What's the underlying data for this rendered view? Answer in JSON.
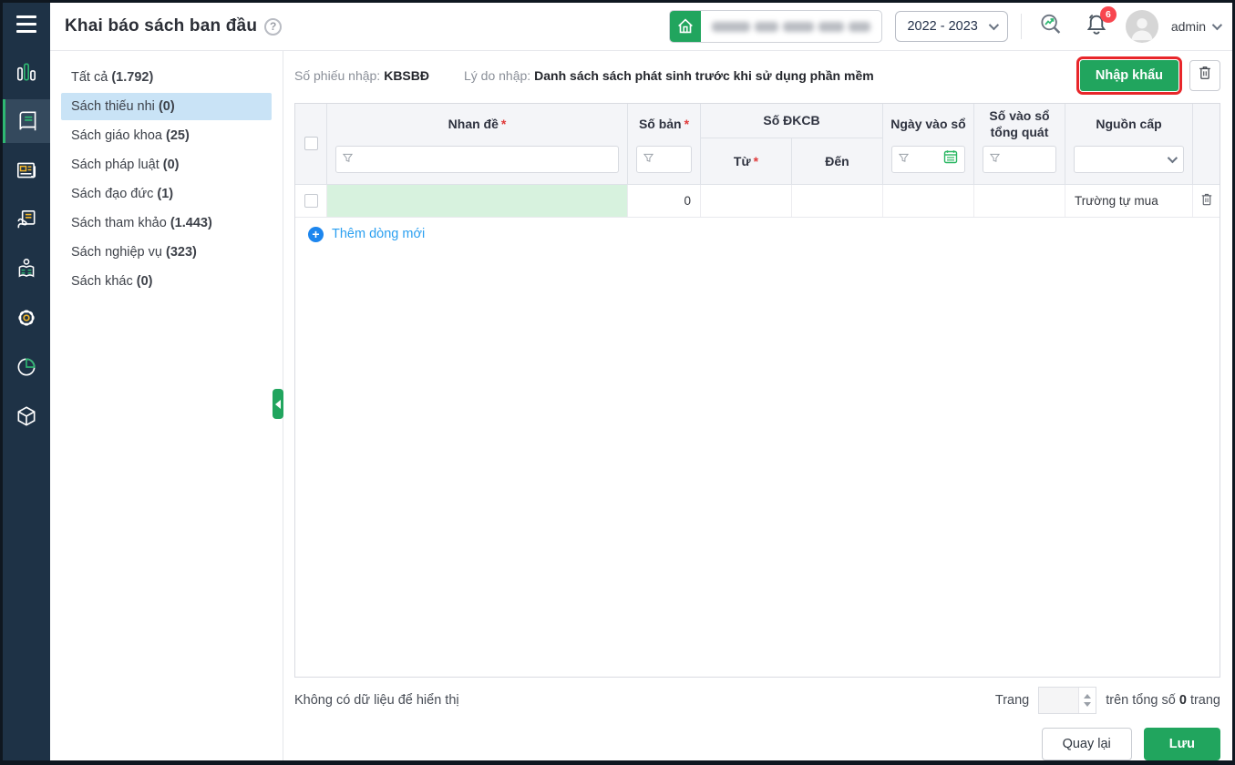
{
  "header": {
    "title": "Khai báo sách ban đầu",
    "help_glyph": "?",
    "year_dropdown": "2022 - 2023",
    "notification_count": "6",
    "user": "admin"
  },
  "colors": {
    "accent_green": "#21a55e",
    "highlight_red": "#e8262a",
    "selected_menu_blue": "#c9e3f6",
    "link_blue": "#2a9ff0",
    "badge_red": "#f8464f",
    "row_highlight_green": "#d7f2de",
    "sidebar_navy": "#1e3246"
  },
  "sidebar_icons": [
    "bar-chart",
    "book",
    "newspaper",
    "book-lending",
    "reader",
    "gear",
    "pie-chart",
    "cube"
  ],
  "menu": {
    "items": [
      {
        "label": "Tất cả",
        "count": "(1.792)",
        "selected": false
      },
      {
        "label": "Sách thiếu nhi",
        "count": "(0)",
        "selected": true
      },
      {
        "label": "Sách giáo khoa",
        "count": "(25)",
        "selected": false
      },
      {
        "label": "Sách pháp luật",
        "count": "(0)",
        "selected": false
      },
      {
        "label": "Sách đạo đức",
        "count": "(1)",
        "selected": false
      },
      {
        "label": "Sách tham khảo",
        "count": "(1.443)",
        "selected": false
      },
      {
        "label": "Sách nghiệp vụ",
        "count": "(323)",
        "selected": false
      },
      {
        "label": "Sách khác",
        "count": "(0)",
        "selected": false
      }
    ]
  },
  "toolbar": {
    "receipt_label": "Số phiếu nhập:",
    "receipt_value": "KBSBĐ",
    "reason_label": "Lý do nhập:",
    "reason_value": "Danh sách sách phát sinh trước khi sử dụng phần mềm",
    "import_button": "Nhập khẩu"
  },
  "table": {
    "required_marker": "*",
    "headers": {
      "title": "Nhan đề",
      "copies": "Số bản",
      "dkcb_group": "Số ĐKCB",
      "from": "Từ",
      "to": "Đến",
      "entry_date": "Ngày vào sổ",
      "general_number": "Số vào sổ tổng quát",
      "source": "Nguồn cấp"
    },
    "row": {
      "copies": "0",
      "source": "Trường tự mua"
    },
    "add_icon": "+",
    "add_row_label": "Thêm dòng mới"
  },
  "footer": {
    "empty_text": "Không có dữ liệu để hiển thị",
    "page_label": "Trang",
    "total_prefix": "trên tổng số",
    "total_pages": "0",
    "total_suffix": "trang",
    "back_button": "Quay lại",
    "save_button": "Lưu"
  }
}
